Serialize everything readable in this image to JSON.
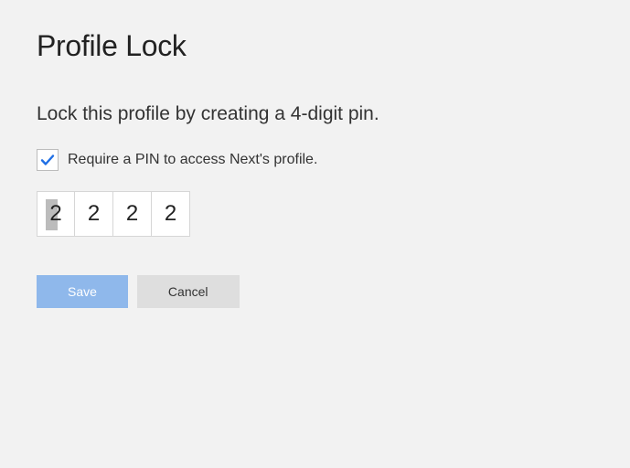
{
  "title": "Profile Lock",
  "subtitle": "Lock this profile by creating a 4-digit pin.",
  "checkbox": {
    "checked": true,
    "label": "Require a PIN to access Next's profile."
  },
  "pin": {
    "digits": [
      "2",
      "2",
      "2",
      "2"
    ],
    "active_index": 0
  },
  "buttons": {
    "save": "Save",
    "cancel": "Cancel"
  }
}
